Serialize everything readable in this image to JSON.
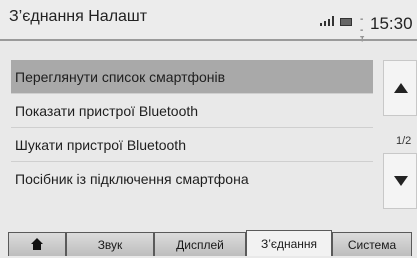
{
  "header": {
    "title": "З’єднання Налашт",
    "status_text": "- - ᵀ",
    "clock": "15:30"
  },
  "menu": {
    "items": [
      {
        "label": "Переглянути список смартфонів"
      },
      {
        "label": "Показати пристрої Bluetooth"
      },
      {
        "label": "Шукати пристрої Bluetooth"
      },
      {
        "label": "Посібник із підключення смартфона"
      }
    ],
    "selected_index": 0
  },
  "scroll": {
    "page_indicator": "1/2",
    "up_icon": "triangle-up-icon",
    "down_icon": "triangle-down-icon"
  },
  "tabs": [
    {
      "icon": "home-icon"
    },
    {
      "label": "Звук"
    },
    {
      "label": "Дисплей"
    },
    {
      "label": "З’єднання",
      "active": true
    },
    {
      "label": "Система"
    }
  ],
  "colors": {
    "selected_row": "#a9a9a9",
    "background": "#e9e9e9",
    "tab_active": "#f2f2f2"
  }
}
